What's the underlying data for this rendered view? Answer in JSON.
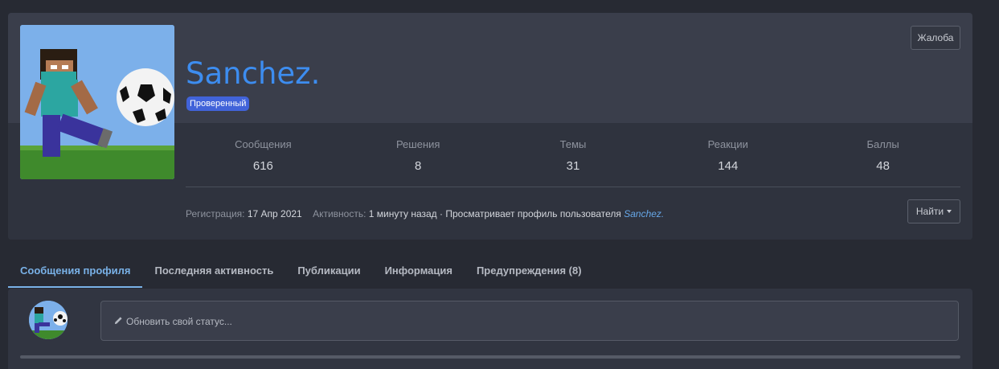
{
  "profile": {
    "username": "Sanchez.",
    "badge": "Проверенный",
    "report_label": "Жалоба",
    "stats": [
      {
        "label": "Сообщения",
        "value": "616"
      },
      {
        "label": "Решения",
        "value": "8"
      },
      {
        "label": "Темы",
        "value": "31"
      },
      {
        "label": "Реакции",
        "value": "144"
      },
      {
        "label": "Баллы",
        "value": "48"
      }
    ],
    "meta": {
      "registration_label": "Регистрация:",
      "registration_value": "17 Апр 2021",
      "activity_label": "Активность:",
      "activity_value": "1 минуту назад",
      "activity_separator": "·",
      "activity_action": "Просматривает профиль пользователя",
      "activity_link": "Sanchez."
    },
    "find_label": "Найти"
  },
  "tabs": [
    {
      "label": "Сообщения профиля",
      "active": true
    },
    {
      "label": "Последняя активность",
      "active": false
    },
    {
      "label": "Публикации",
      "active": false
    },
    {
      "label": "Информация",
      "active": false
    },
    {
      "label": "Предупреждения (8)",
      "active": false
    }
  ],
  "status": {
    "placeholder": "Обновить свой статус...",
    "icon": "pencil-icon"
  },
  "colors": {
    "username": "#3d8df0",
    "badge": "#4163d9",
    "active_tab": "#79b1e7",
    "link": "#66a6e6"
  }
}
